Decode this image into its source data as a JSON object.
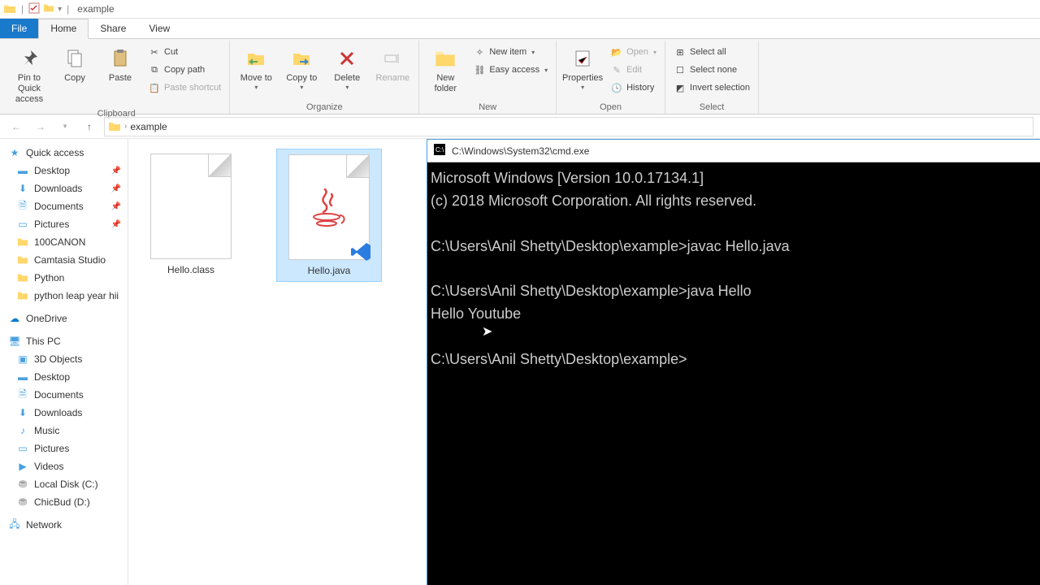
{
  "window": {
    "title": "example"
  },
  "tabs": {
    "file": "File",
    "home": "Home",
    "share": "Share",
    "view": "View"
  },
  "ribbon": {
    "clipboard": {
      "label": "Clipboard",
      "pin": "Pin to Quick access",
      "copy": "Copy",
      "paste": "Paste",
      "cut": "Cut",
      "copypath": "Copy path",
      "pasteshortcut": "Paste shortcut"
    },
    "organize": {
      "label": "Organize",
      "moveto": "Move to",
      "copyto": "Copy to",
      "delete": "Delete",
      "rename": "Rename"
    },
    "new": {
      "label": "New",
      "newfolder": "New folder",
      "newitem": "New item",
      "easyaccess": "Easy access"
    },
    "open": {
      "label": "Open",
      "properties": "Properties",
      "open": "Open",
      "edit": "Edit",
      "history": "History"
    },
    "select": {
      "label": "Select",
      "all": "Select all",
      "none": "Select none",
      "invert": "Invert selection"
    }
  },
  "breadcrumb": {
    "folder": "example"
  },
  "nav": {
    "quickaccess": "Quick access",
    "desktop": "Desktop",
    "downloads": "Downloads",
    "documents": "Documents",
    "pictures": "Pictures",
    "canon": "100CANON",
    "camtasia": "Camtasia Studio",
    "python": "Python",
    "pythonleap": "python leap year hii",
    "onedrive": "OneDrive",
    "thispc": "This PC",
    "objects3d": "3D Objects",
    "desktop2": "Desktop",
    "documents2": "Documents",
    "downloads2": "Downloads",
    "music": "Music",
    "pictures2": "Pictures",
    "videos": "Videos",
    "localc": "Local Disk (C:)",
    "chicbud": "ChicBud (D:)",
    "network": "Network"
  },
  "files": {
    "helloclass": "Hello.class",
    "hellojava": "Hello.java"
  },
  "cmd": {
    "title": "C:\\Windows\\System32\\cmd.exe",
    "line1": "Microsoft Windows [Version 10.0.17134.1]",
    "line2": "(c) 2018 Microsoft Corporation. All rights reserved.",
    "line3": "C:\\Users\\Anil Shetty\\Desktop\\example>javac Hello.java",
    "line4": "C:\\Users\\Anil Shetty\\Desktop\\example>java Hello",
    "line5": "Hello Youtube",
    "line6": "C:\\Users\\Anil Shetty\\Desktop\\example>"
  }
}
